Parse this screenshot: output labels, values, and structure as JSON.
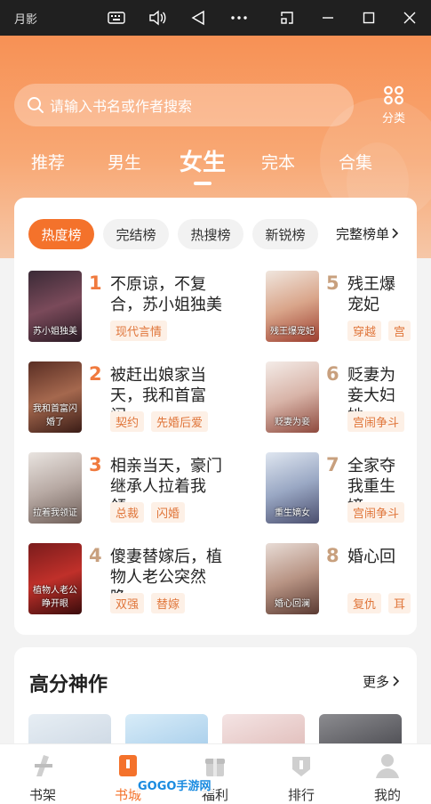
{
  "window": {
    "title": "月影"
  },
  "search": {
    "placeholder": "请输入书名或作者搜索"
  },
  "category": {
    "label": "分类"
  },
  "tabs": [
    "推荐",
    "男生",
    "女生",
    "完本",
    "合集"
  ],
  "rank_tabs": [
    "热度榜",
    "完结榜",
    "热搜榜",
    "新锐榜"
  ],
  "full_rank_label": "完整榜单",
  "books": [
    {
      "rank": "1",
      "title": "不原谅，不复合，苏小姐独美",
      "tags": [
        "现代言情"
      ],
      "cover_text": "苏小姐独美"
    },
    {
      "rank": "2",
      "title": "被赶出娘家当天，我和首富闪…",
      "tags": [
        "契约",
        "先婚后爱"
      ],
      "cover_text": "我和首富闪婚了"
    },
    {
      "rank": "3",
      "title": "相亲当天，豪门继承人拉着我领…",
      "tags": [
        "总裁",
        "闪婚"
      ],
      "cover_text": "拉着我领证"
    },
    {
      "rank": "4",
      "title": "傻妻替嫁后，植物人老公突然睁…",
      "tags": [
        "双强",
        "替嫁"
      ],
      "cover_text": "植物人老公睁开眼"
    },
    {
      "rank": "5",
      "title": "残王爆宠妃",
      "tags": [
        "穿越",
        "宫"
      ],
      "cover_text": "残王爆宠妃"
    },
    {
      "rank": "6",
      "title": "贬妻为妾大妇她",
      "tags": [
        "宫闹争斗"
      ],
      "cover_text": "贬妻为妾"
    },
    {
      "rank": "7",
      "title": "全家夺我重生嫡",
      "tags": [
        "宫闹争斗"
      ],
      "cover_text": "重生嫡女"
    },
    {
      "rank": "8",
      "title": "婚心回",
      "tags": [
        "复仇",
        "耳"
      ],
      "cover_text": "婚心回澜"
    }
  ],
  "section": {
    "title": "高分神作",
    "more": "更多"
  },
  "bottom_nav": [
    "书架",
    "书城",
    "福利",
    "排行",
    "我的"
  ],
  "watermark": "GOGO手游网",
  "colors": {
    "accent": "#f4722b",
    "header_top": "#f79155",
    "tag_text": "#e0763b"
  }
}
